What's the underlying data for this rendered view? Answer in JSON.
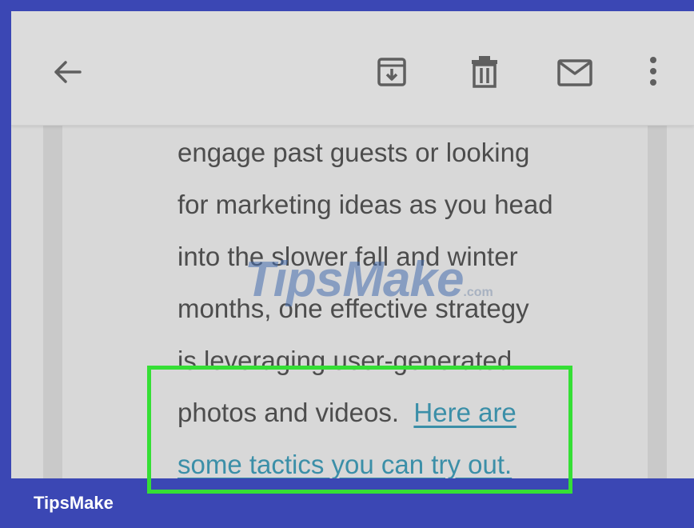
{
  "toolbar": {
    "icons": [
      "back-arrow-icon",
      "archive-icon",
      "trash-icon",
      "mail-icon",
      "more-vert-icon"
    ],
    "icon_color": "#5f5f5f"
  },
  "body": {
    "lines": [
      "engage past guests or looking",
      "for marketing ideas as you head",
      "into the slower fall and winter",
      "months, one effective strategy",
      "is leveraging user-generated",
      "photos and videos."
    ],
    "link_line1": "Here are",
    "link_line2": "some tactics you can try out."
  },
  "watermark": {
    "main": "TipsMake",
    "suffix": ".com"
  },
  "footer": {
    "brand": "TipsMake"
  },
  "colors": {
    "highlight": "#35df35",
    "link": "#3b8fa8",
    "brand_bar": "#3b47b4"
  }
}
